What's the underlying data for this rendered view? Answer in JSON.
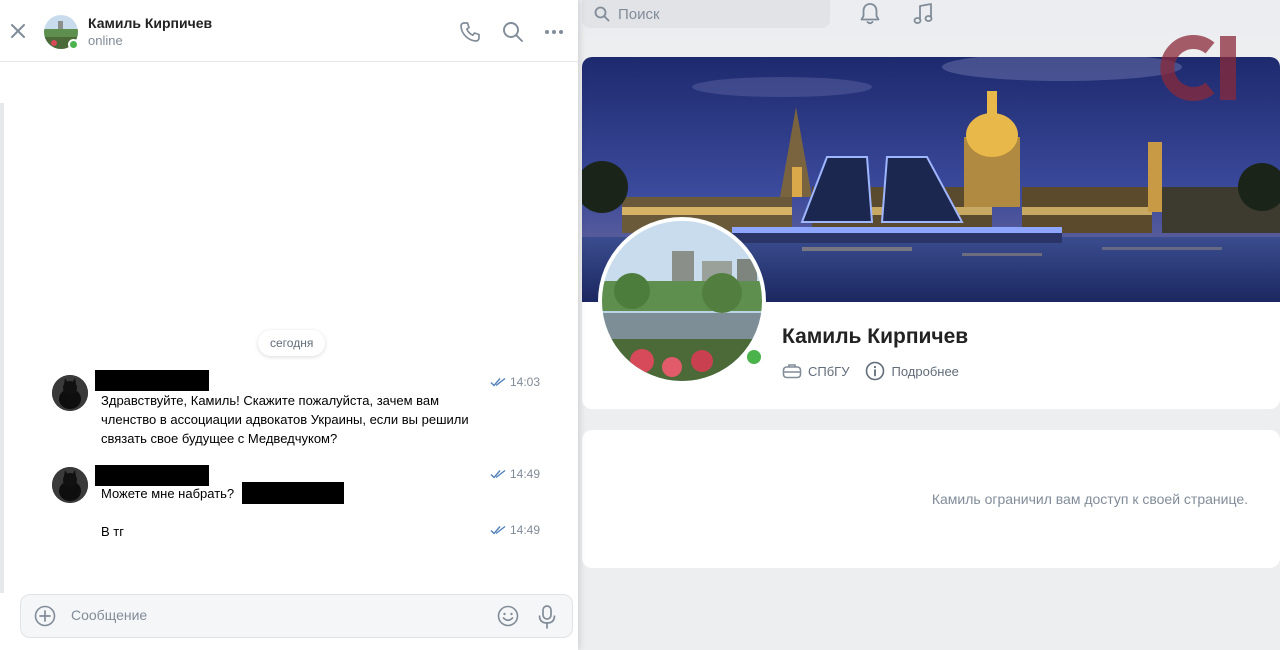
{
  "chat": {
    "contact_name": "Камиль Кирпичев",
    "contact_status": "online",
    "date_separator": "сегодня",
    "messages": [
      {
        "text": "Здравствуйте, Камиль! Скажите пожалуйста, зачем вам членство в ассоциации адвокатов Украины, если вы решили связать свое будущее с Медведчуком?",
        "time": "14:03"
      },
      {
        "text": "Можете мне набрать?",
        "time": "14:49"
      },
      {
        "text": "В тг",
        "time": "14:49"
      }
    ],
    "composer_placeholder": "Сообщение"
  },
  "topbar": {
    "search_placeholder": "Поиск"
  },
  "profile": {
    "name": "Камиль Кирпичев",
    "university": "СПбГУ",
    "details_label": "Подробнее",
    "restricted_notice": "Камиль ограничил вам доступ к своей странице."
  },
  "colors": {
    "online": "#4bb34b",
    "accent": "#2a5885",
    "watermark": "#8a2a3a"
  }
}
